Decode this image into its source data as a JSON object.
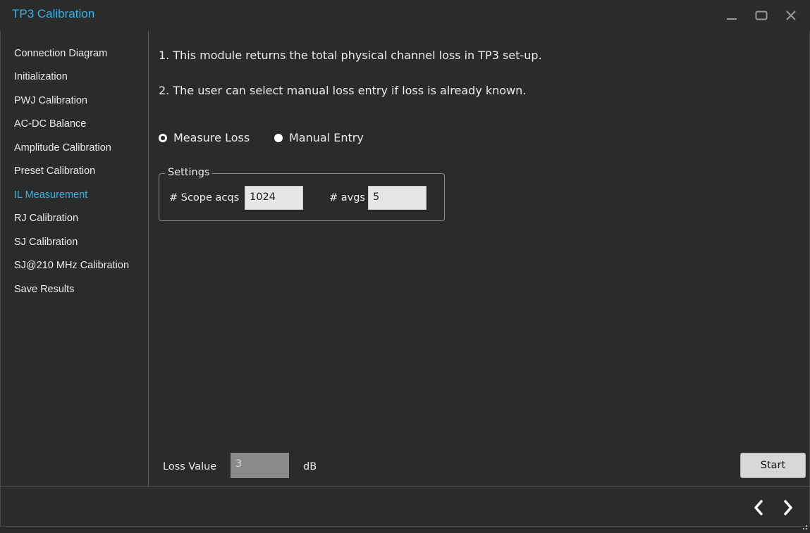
{
  "window": {
    "title": "TP3 Calibration",
    "accent_color": "#36b4e6",
    "controls": [
      "minimize-icon",
      "maximize-icon",
      "close-icon"
    ]
  },
  "sidebar": {
    "items": [
      {
        "label": "Connection Diagram",
        "active": false
      },
      {
        "label": "Initialization",
        "active": false
      },
      {
        "label": "PWJ Calibration",
        "active": false
      },
      {
        "label": "AC-DC Balance",
        "active": false
      },
      {
        "label": "Amplitude Calibration",
        "active": false
      },
      {
        "label": "Preset Calibration",
        "active": false
      },
      {
        "label": "IL Measurement",
        "active": true
      },
      {
        "label": "RJ Calibration",
        "active": false
      },
      {
        "label": "SJ Calibration",
        "active": false
      },
      {
        "label": "SJ@210 MHz Calibration",
        "active": false
      },
      {
        "label": "Save Results",
        "active": false
      }
    ]
  },
  "main": {
    "instructions": [
      "1. This module returns the total physical channel loss in TP3 set-up.",
      "2. The user can select manual loss entry if loss is already known."
    ],
    "mode_options": [
      {
        "label": "Measure Loss",
        "selected": true
      },
      {
        "label": "Manual Entry",
        "selected": false
      }
    ],
    "settings": {
      "title": "Settings",
      "scope_acqs_label": "# Scope acqs",
      "scope_acqs_value": "1024",
      "avgs_label": "# avgs",
      "avgs_value": "5"
    },
    "loss": {
      "label": "Loss Value",
      "value": "3",
      "unit": "dB"
    },
    "start_label": "Start"
  },
  "footer": {
    "icons": [
      "chevron-left-icon",
      "chevron-right-icon",
      "resize-grip-icon"
    ]
  }
}
